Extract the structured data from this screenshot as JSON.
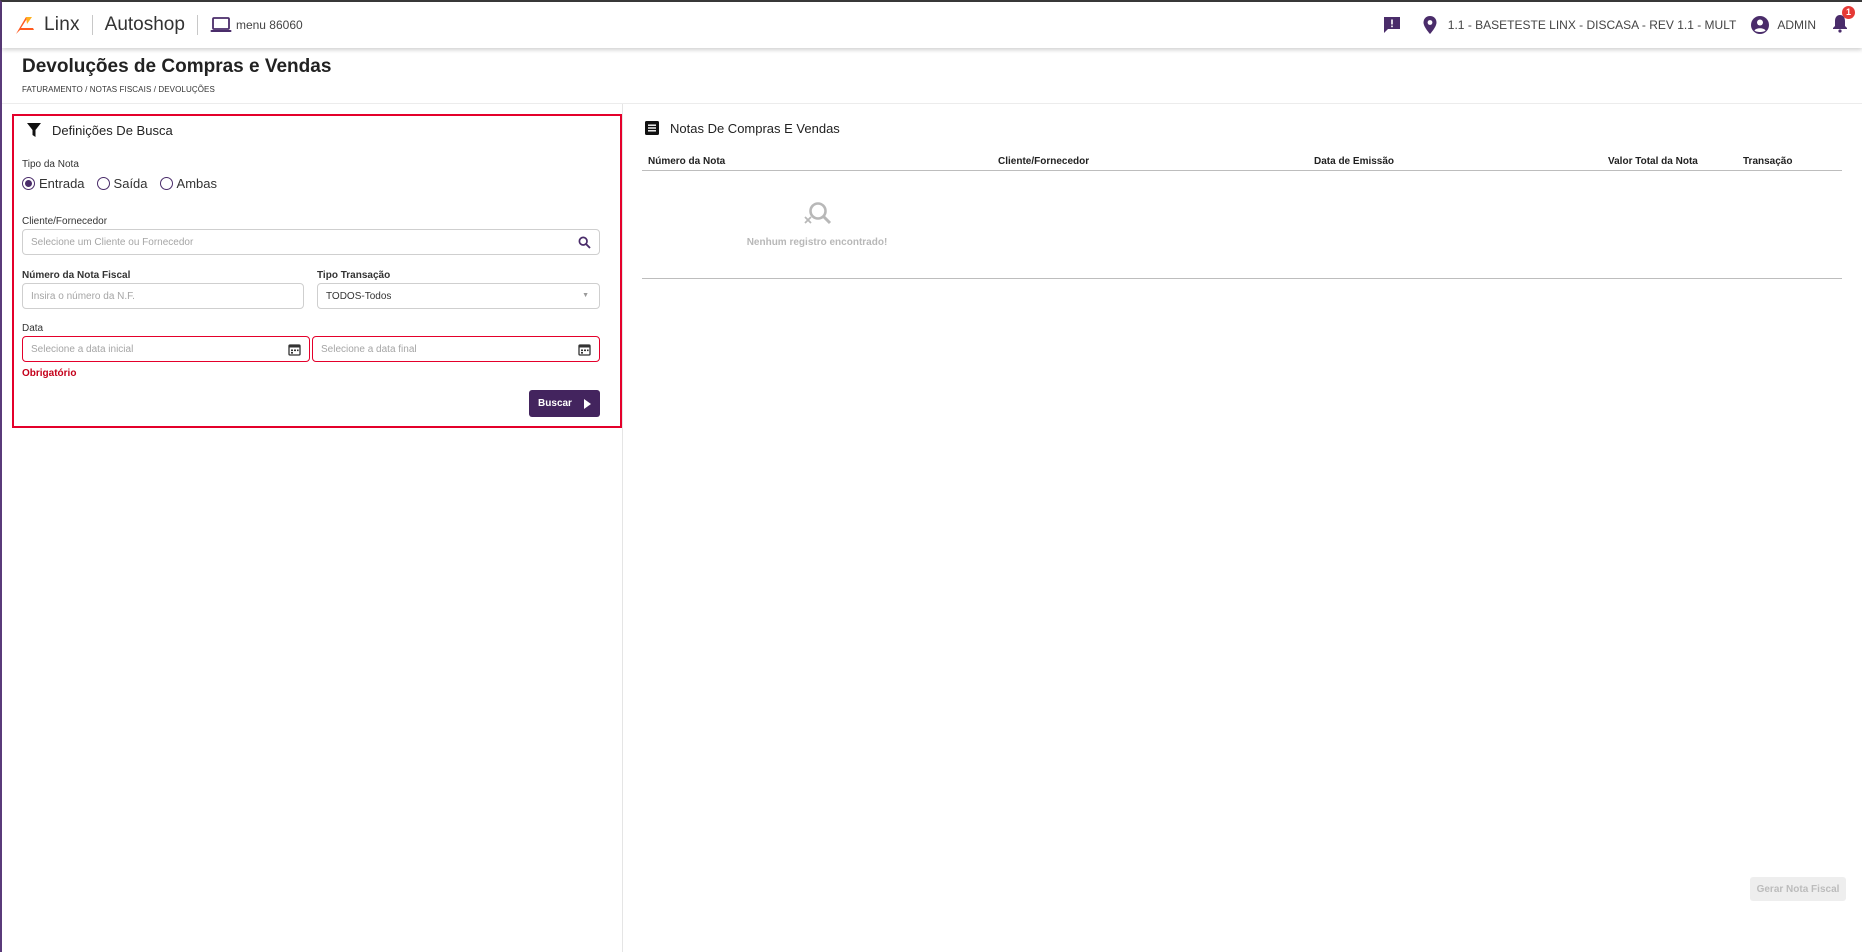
{
  "topbar": {
    "brand": "Linx",
    "product": "Autoshop",
    "menu_code": "menu 86060",
    "store": "1.1 - BASETESTE LINX - DISCASA - REV 1.1 - MULT",
    "user": "ADMIN",
    "notification_count": "1",
    "icons": [
      "feedback-icon",
      "location-pin-icon",
      "account-circle-icon",
      "bell-icon",
      "laptop-icon"
    ],
    "accent_color": "#4a2c6a",
    "logo_color": "#ff5a1f"
  },
  "page": {
    "title": "Devoluções de Compras e Vendas",
    "breadcrumb": "FATURAMENTO / NOTAS FISCAIS / DEVOLUÇÕES"
  },
  "search": {
    "title": "Definições De Busca",
    "tipo_nota_label": "Tipo da Nota",
    "radio_options": [
      "Entrada",
      "Saída",
      "Ambas"
    ],
    "radio_selected": "Entrada",
    "cliente_label": "Cliente/Fornecedor",
    "cliente_placeholder": "Selecione um Cliente ou Fornecedor",
    "numero_label": "Número da Nota Fiscal",
    "numero_placeholder": "Insira o número da N.F.",
    "tipo_transacao_label": "Tipo Transação",
    "tipo_transacao_value": "TODOS-Todos",
    "data_label": "Data",
    "data_inicial_placeholder": "Selecione a data inicial",
    "data_final_placeholder": "Selecione a data final",
    "error_message": "Obrigatório",
    "buscar_label": "Buscar",
    "error_color": "#e4002b",
    "button_color": "#43245e"
  },
  "results": {
    "title": "Notas De Compras E Vendas",
    "columns": [
      "Número da Nota",
      "Cliente/Fornecedor",
      "Data de Emissão",
      "Valor Total da Nota",
      "Transação"
    ],
    "rows": [],
    "empty_message": "Nenhum registro encontrado!",
    "gerar_label": "Gerar Nota Fiscal"
  }
}
